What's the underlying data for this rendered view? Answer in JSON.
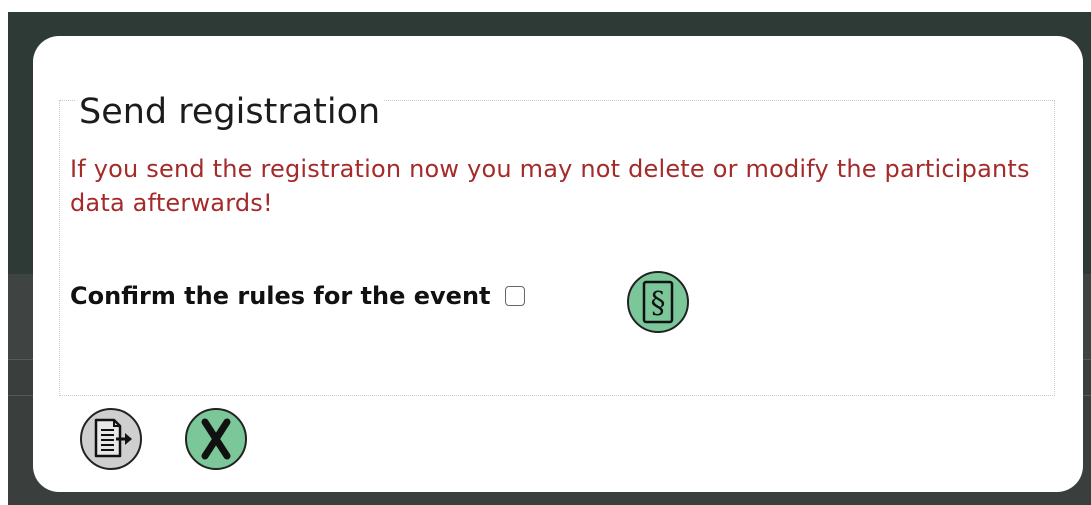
{
  "dialog": {
    "title": "Send registration",
    "warning": "If you send the registration now you may not delete or modify the participants data afterwards!",
    "confirm_label": "Confirm the rules for the event",
    "confirm_checked": false
  },
  "icons": {
    "rules": "paragraph-section-icon",
    "submit": "document-send-icon",
    "cancel": "x-cancel-icon"
  },
  "colors": {
    "warning_text": "#a52a2a",
    "button_green": "#7cc79a",
    "button_gray": "#cfcfcf",
    "backdrop": "#2e3a35"
  }
}
